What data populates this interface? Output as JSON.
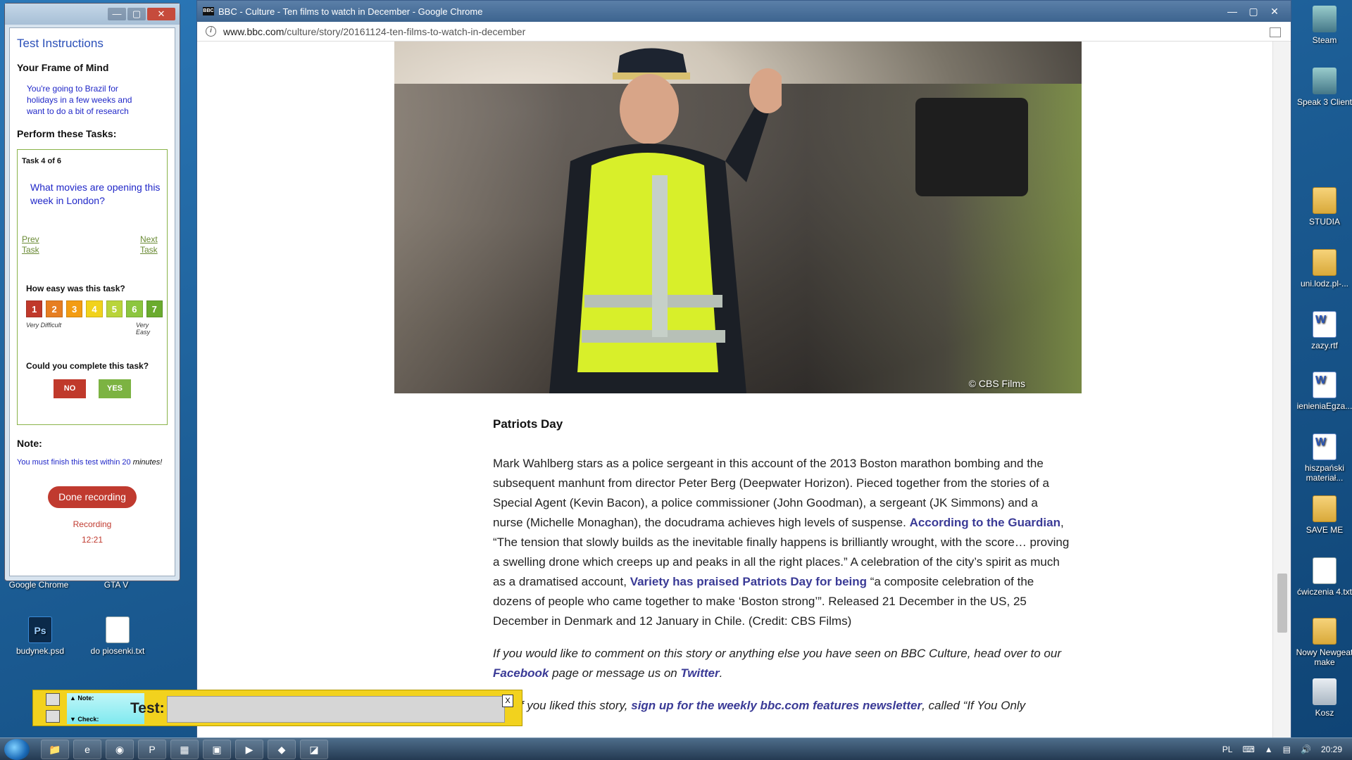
{
  "desktop": {
    "icons": [
      {
        "label": "Google Chrome"
      },
      {
        "label": "GTA V"
      },
      {
        "label": "budynek.psd"
      },
      {
        "label": "do piosenki.txt"
      },
      {
        "label": "Steam"
      },
      {
        "label": "Speak 3 Client"
      },
      {
        "label": "STUDIA"
      },
      {
        "label": "uni.lodz.pl-..."
      },
      {
        "label": "zazy.rtf"
      },
      {
        "label": "ienieniaEgza..."
      },
      {
        "label": "hiszpański materiał..."
      },
      {
        "label": "SAVE ME"
      },
      {
        "label": "ćwiczenia 4.txt"
      },
      {
        "label": "Nowy Newgeat make"
      },
      {
        "label": "Kosz"
      }
    ]
  },
  "test_panel": {
    "title": "Test Instructions",
    "frame_heading": "Your Frame of Mind",
    "frame_text": "You're going to Brazil for holidays in a few weeks and want to do a bit of research",
    "tasks_heading": "Perform these Tasks:",
    "task_count": "Task 4 of 6",
    "task_question": "What movies are opening this week in London?",
    "prev_label": "Prev Task",
    "next_label": "Next Task",
    "easy_question": "How easy was this task?",
    "ratings": [
      {
        "label": "1",
        "color": "#c0392b"
      },
      {
        "label": "2",
        "color": "#e67e22"
      },
      {
        "label": "3",
        "color": "#f39c12"
      },
      {
        "label": "4",
        "color": "#f1d21c"
      },
      {
        "label": "5",
        "color": "#b9d43a"
      },
      {
        "label": "6",
        "color": "#8cc63f"
      },
      {
        "label": "7",
        "color": "#6aab2e"
      }
    ],
    "rating_low": "Very Difficult",
    "rating_high": "Very Easy",
    "complete_question": "Could you complete this task?",
    "no_label": "NO",
    "yes_label": "YES",
    "no_color": "#c0392b",
    "yes_color": "#7cb342",
    "note_heading": "Note:",
    "note_text": "You must finish this test within 20",
    "note_text_em": "minutes!",
    "done_label": "Done recording",
    "recording_label": "Recording",
    "recording_time": "12:21"
  },
  "browser": {
    "title": "BBC - Culture - Ten films to watch in December - Google Chrome",
    "favicon": "BBC",
    "url_domain": "www.bbc.com",
    "url_path": "/culture/story/20161124-ten-films-to-watch-in-december"
  },
  "article": {
    "photo_caption": "© CBS Films",
    "heading": "Patriots Day",
    "p1_a": "Mark Wahlberg stars as a police sergeant in this account of the 2013 Boston marathon bombing and the subsequent manhunt from director Peter Berg (Deepwater Horizon). Pieced together from the stories of a Special Agent (Kevin Bacon), a police commissioner (John Goodman), a sergeant (JK Simmons) and a nurse (Michelle Monaghan), the docudrama achieves high levels of suspense.",
    "p1_link1": "According to the Guardian",
    "p1_b": ", “The tension that slowly builds as the inevitable finally happens is brilliantly wrought, with the score… proving a swelling drone which creeps up and peaks in all the right places.” A celebration of the city’s spirit as much as a dramatised account,",
    "p1_link2": "Variety has praised Patriots Day for being",
    "p1_c": "“a composite celebration of the dozens of people who came together to make ‘Boston strong’”. Released 21 December in the US, 25 December in Denmark and 12 January in Chile. (Credit: CBS Films)",
    "p2_a": "If you would like to comment on this story or anything else you have seen on BBC Culture, head over to our",
    "p2_link1": "Facebook",
    "p2_b": "page or message us on",
    "p2_link2": "Twitter",
    "p2_c": ".",
    "p3_a": "And if you liked this story,",
    "p3_link": "sign up for the weekly bbc.com features newsletter",
    "p3_b": ", called “If You Only"
  },
  "note_bar": {
    "note_tab": "▲ Note:",
    "check_tab": "▼ Check:",
    "label": "Test:",
    "input_value": "",
    "close": "X"
  },
  "taskbar": {
    "lang": "PL",
    "clock": "20:29"
  }
}
